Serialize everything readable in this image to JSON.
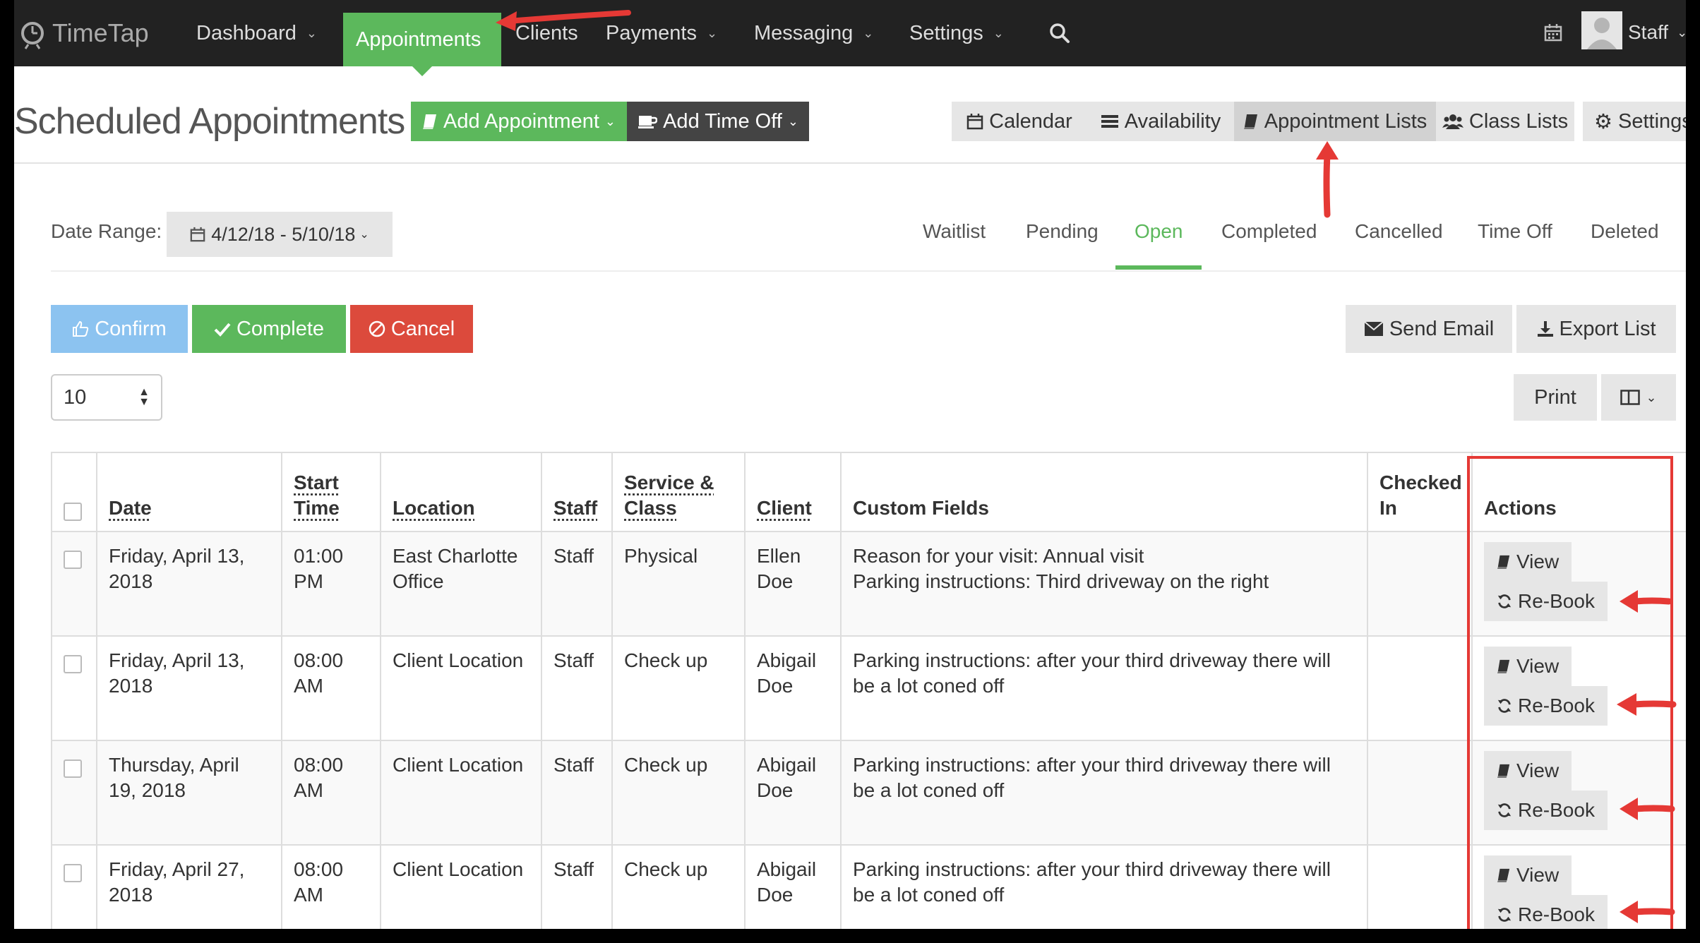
{
  "nav": {
    "logo": "TimeTap",
    "items": [
      {
        "label": "Dashboard",
        "dropdown": true
      },
      {
        "label": "Appointments",
        "dropdown": false,
        "active": true
      },
      {
        "label": "Clients",
        "dropdown": false
      },
      {
        "label": "Payments",
        "dropdown": true
      },
      {
        "label": "Messaging",
        "dropdown": true
      },
      {
        "label": "Settings",
        "dropdown": true
      }
    ],
    "user": "Staff"
  },
  "header": {
    "title": "Scheduled Appointments",
    "add_appointment": "Add Appointment",
    "add_time_off": "Add Time Off",
    "views": [
      "Calendar",
      "Availability",
      "Appointment Lists",
      "Class Lists"
    ],
    "settings": "Settings"
  },
  "filters": {
    "date_range_label": "Date Range:",
    "date_range_value": "4/12/18 - 5/10/18",
    "tabs": [
      "Waitlist",
      "Pending",
      "Open",
      "Completed",
      "Cancelled",
      "Time Off",
      "Deleted"
    ],
    "active_tab": "Open"
  },
  "actions": {
    "confirm": "Confirm",
    "complete": "Complete",
    "cancel": "Cancel",
    "send_email": "Send Email",
    "export_list": "Export List",
    "page_size": "10",
    "print": "Print"
  },
  "table": {
    "headers": {
      "date": "Date",
      "start_time": "Start Time",
      "location": "Location",
      "staff": "Staff",
      "service_class": "Service & Class",
      "client": "Client",
      "custom_fields": "Custom Fields",
      "checked_in": "Checked In",
      "actions": "Actions"
    },
    "view_label": "View",
    "rebook_label": "Re-Book",
    "rows": [
      {
        "date": "Friday, April 13, 2018",
        "time": "01:00 PM",
        "location": "East Charlotte Office",
        "staff": "Staff",
        "service": "Physical",
        "client": "Ellen Doe",
        "custom1": "Reason for your visit: Annual visit",
        "custom2": "Parking instructions: Third driveway on the right"
      },
      {
        "date": "Friday, April 13, 2018",
        "time": "08:00 AM",
        "location": "Client Location",
        "staff": "Staff",
        "service": "Check up",
        "client": "Abigail Doe",
        "custom1": "Parking instructions: after your third driveway there will be a lot coned off",
        "custom2": ""
      },
      {
        "date": "Thursday, April 19, 2018",
        "time": "08:00 AM",
        "location": "Client Location",
        "staff": "Staff",
        "service": "Check up",
        "client": "Abigail Doe",
        "custom1": "Parking instructions: after your third driveway there will be a lot coned off",
        "custom2": ""
      },
      {
        "date": "Friday, April 27, 2018",
        "time": "08:00 AM",
        "location": "Client Location",
        "staff": "Staff",
        "service": "Check up",
        "client": "Abigail Doe",
        "custom1": "Parking instructions: after your third driveway there will be a lot coned off",
        "custom2": ""
      }
    ]
  },
  "colors": {
    "nav_bg": "#222222",
    "green": "#5cb85c",
    "confirm_blue": "#8cc3f0",
    "cancel_red": "#dc4a3c",
    "annotation_red": "#e53935"
  }
}
